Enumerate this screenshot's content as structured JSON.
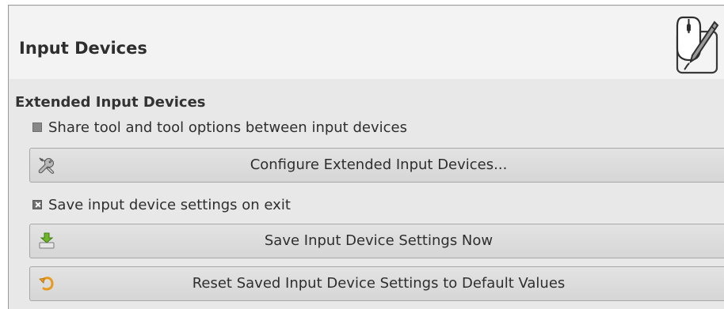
{
  "header": {
    "title": "Input Devices",
    "icon": "input-devices-tablet-mouse-icon"
  },
  "extended": {
    "section_title": "Extended Input Devices",
    "share_tool_label": "Share tool and tool options between input devices",
    "share_tool_checked": false,
    "configure_button_label": "Configure Extended Input Devices...",
    "configure_button_icon": "wrench-screwdriver-icon",
    "save_on_exit_label": "Save input device settings on exit",
    "save_on_exit_checked": true,
    "save_now_button_label": "Save Input Device Settings Now",
    "save_now_button_icon": "download-save-icon",
    "reset_button_label": "Reset Saved Input Device Settings to Default Values",
    "reset_button_icon": "reset-undo-icon"
  },
  "colors": {
    "panel_bg": "#e8e8e8",
    "header_bg": "#f3f3f3",
    "button_bg": "#dcdcdc",
    "save_icon_green": "#6fb52c",
    "reset_icon_orange": "#e89a1e"
  }
}
